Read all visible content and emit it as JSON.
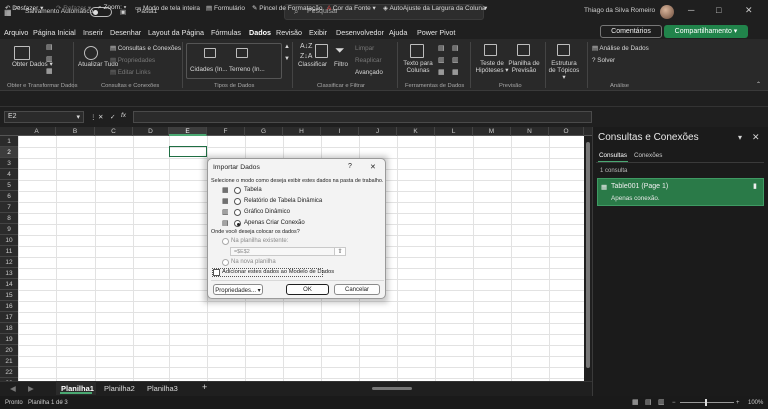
{
  "titlebar": {
    "autosave_label": "Salvamento Automático",
    "autosave_state": "off",
    "filename": "Pasta1",
    "search_placeholder": "Pesquisar",
    "user": "Thiago da Silva Romeiro"
  },
  "menu": {
    "tabs": [
      "Arquivo",
      "Página Inicial",
      "Inserir",
      "Desenhar",
      "Layout da Página",
      "Fórmulas",
      "Dados",
      "Revisão",
      "Exibir",
      "Desenvolvedor",
      "Ajuda",
      "Power Pivot"
    ],
    "active": "Dados",
    "comentarios": "Comentários",
    "compartilhamento": "Compartilhamento"
  },
  "ribbon": {
    "obter_dados": "Obter Dados",
    "consultas_conexoes": "Consultas e Conexões",
    "propriedades": "Propriedades",
    "editar_links": "Editar Links",
    "atualizar_tudo": "Atualizar Tudo",
    "cidades": "Cidades (In...",
    "terreno": "Terreno (In...",
    "classificar": "Classificar",
    "filtro": "Filtro",
    "limpar": "Limpar",
    "reaplicar": "Reaplicar",
    "avancado": "Avançado",
    "texto_colunas": "Texto para Colunas",
    "teste_hipoteses": "Teste de Hipóteses",
    "planilha_previsao": "Planilha de Previsão",
    "estrutura_topicos": "Estrutura de Tópicos",
    "analise_dados": "Análise de Dados",
    "solver": "Solver",
    "groups": {
      "obter": "Obter e Transformar Dados",
      "consultas": "Consultas e Conexões",
      "tipos": "Tipos de Dados",
      "classificar": "Classificar e Filtrar",
      "ferramentas": "Ferramentas de Dados",
      "previsao": "Previsão",
      "analise": "Análise"
    }
  },
  "qat": {
    "desfazer": "Desfazer",
    "refazer": "Refazer",
    "zoom": "Zoom:",
    "tela_inteira": "Modo de tela inteira",
    "formulario": "Formulário",
    "pincel": "Pincel de Formatação",
    "cor_fonte": "Cor da Fonte",
    "autoajuste": "AutoAjuste da Largura da Coluna"
  },
  "formula_bar": {
    "name_box": "E2",
    "fx": "fx",
    "value": ""
  },
  "grid": {
    "columns": [
      "A",
      "B",
      "C",
      "D",
      "E",
      "F",
      "G",
      "H",
      "I",
      "J",
      "K",
      "L",
      "M",
      "N",
      "O"
    ],
    "rows": [
      "1",
      "2",
      "3",
      "4",
      "5",
      "6",
      "7",
      "8",
      "9",
      "10",
      "11",
      "12",
      "13",
      "14",
      "15",
      "16",
      "17",
      "18",
      "19",
      "20",
      "21",
      "22",
      "23"
    ],
    "selected": "E2"
  },
  "sheets": {
    "tabs": [
      "Planilha1",
      "Planilha2",
      "Planilha3"
    ],
    "active": "Planilha1",
    "add": "+"
  },
  "status": {
    "ready": "Pronto",
    "sheet_of": "Planilha 1 de 3",
    "zoom": "100%"
  },
  "pane": {
    "title": "Consultas e Conexões",
    "tabs": [
      "Consultas",
      "Conexões"
    ],
    "count": "1 consulta",
    "query_name": "Table001 (Page 1)",
    "query_status": "Apenas conexão."
  },
  "dialog": {
    "title": "Importar Dados",
    "help": "?",
    "close": "✕",
    "prompt": "Selecione o modo como deseja exibir estes dados na pasta de trabalho.",
    "options": [
      "Tabela",
      "Relatório de Tabela Dinâmica",
      "Gráfico Dinâmico",
      "Apenas Criar Conexão"
    ],
    "selected": "Apenas Criar Conexão",
    "where_prompt": "Onde você deseja colocar os dados?",
    "existing": "Na planilha existente:",
    "existing_ref": "=$E$2",
    "new_sheet": "Na nova planilha",
    "add_model": "Adicionar estes dados ao Modelo de Dados",
    "properties": "Propriedades...",
    "ok": "OK",
    "cancel": "Cancelar"
  }
}
